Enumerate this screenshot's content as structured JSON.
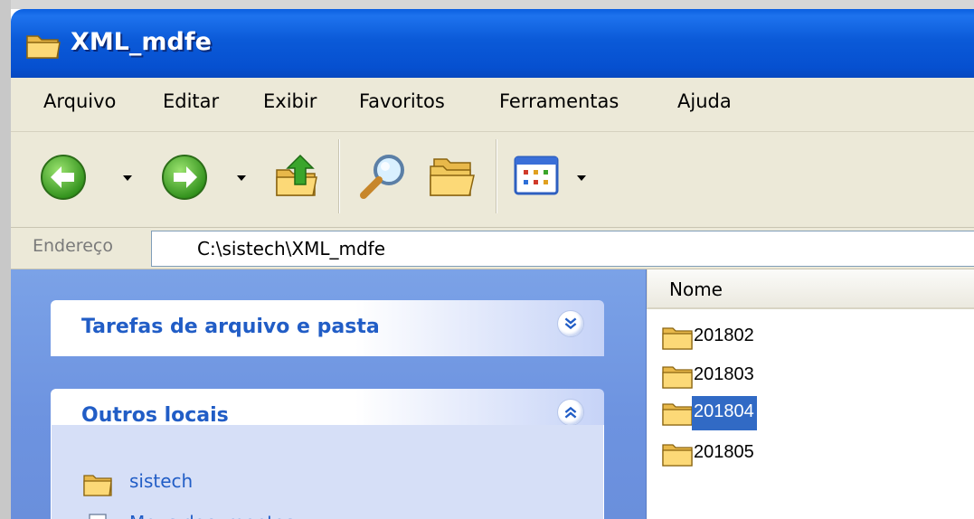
{
  "window": {
    "title": "XML_mdfe"
  },
  "menu": {
    "items": [
      "Arquivo",
      "Editar",
      "Exibir",
      "Favoritos",
      "Ferramentas",
      "Ajuda"
    ]
  },
  "toolbar": {
    "buttons": [
      "back-icon",
      "forward-icon",
      "up-folder-icon",
      "search-icon",
      "folders-icon",
      "views-icon"
    ]
  },
  "address": {
    "label": "Endereço",
    "value": "C:\\sistech\\XML_mdfe"
  },
  "taskpane": {
    "panels": [
      {
        "title": "Tarefas de arquivo e pasta",
        "state": "collapsed"
      },
      {
        "title": "Outros locais",
        "state": "expanded",
        "links": [
          {
            "label": "sistech",
            "icon": "folder-icon"
          },
          {
            "label": "Meus documentos",
            "icon": "my-documents-icon"
          }
        ]
      }
    ]
  },
  "filelist": {
    "column_header": "Nome",
    "items": [
      {
        "name": "201802",
        "selected": false
      },
      {
        "name": "201803",
        "selected": false
      },
      {
        "name": "201804",
        "selected": true
      },
      {
        "name": "201805",
        "selected": false
      }
    ]
  },
  "colors": {
    "titlebar": "#0a5fe0",
    "chrome": "#ece9d8",
    "taskpane": "#6d93e0",
    "panel_title": "#215dc6",
    "selection": "#316ac5"
  }
}
